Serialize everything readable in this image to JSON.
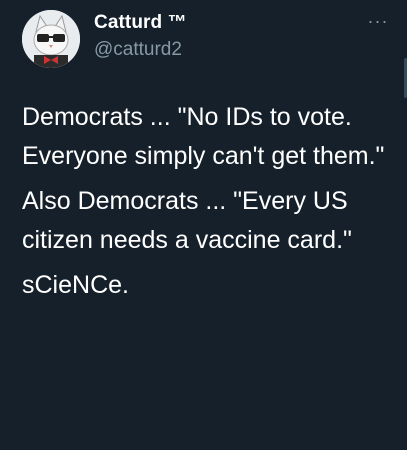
{
  "user": {
    "display_name": "Catturd ™",
    "handle": "@catturd2",
    "avatar_icon": "cat-avatar-icon"
  },
  "more_label": "···",
  "tweet": {
    "paragraphs": [
      "Democrats ... \"No IDs to vote. Everyone simply can't get them.\"",
      "Also Democrats ... \"Every US citizen needs a vaccine card.\"",
      "sCieNCe."
    ]
  },
  "colors": {
    "background": "#15202b",
    "text": "#ffffff",
    "secondary": "#8899a6"
  }
}
